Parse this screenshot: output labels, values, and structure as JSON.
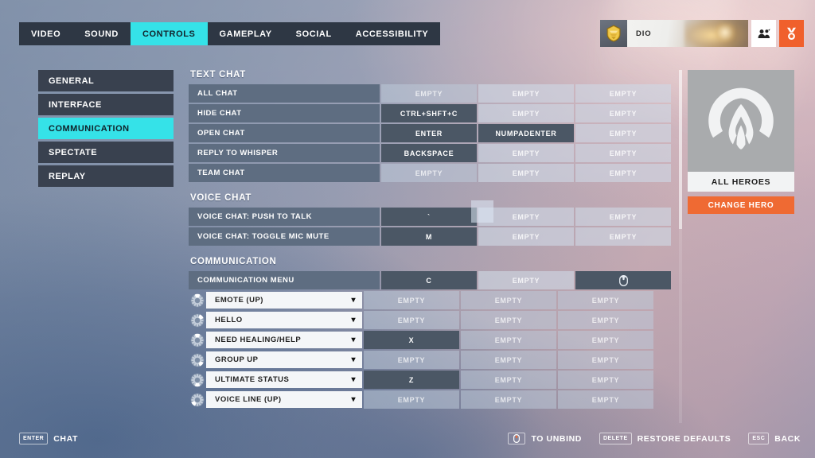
{
  "nav": {
    "tabs": [
      {
        "label": "VIDEO",
        "active": false
      },
      {
        "label": "SOUND",
        "active": false
      },
      {
        "label": "CONTROLS",
        "active": true
      },
      {
        "label": "GAMEPLAY",
        "active": false
      },
      {
        "label": "SOCIAL",
        "active": false
      },
      {
        "label": "ACCESSIBILITY",
        "active": false
      }
    ]
  },
  "player": {
    "name": "DIO",
    "badge_icon": "rank-badge-icon",
    "group_icon": "group-icon",
    "medal_icon": "medal-icon"
  },
  "sidebar": {
    "items": [
      {
        "label": "GENERAL",
        "active": false
      },
      {
        "label": "INTERFACE",
        "active": false
      },
      {
        "label": "COMMUNICATION",
        "active": true
      },
      {
        "label": "SPECTATE",
        "active": false
      },
      {
        "label": "REPLAY",
        "active": false
      }
    ]
  },
  "empty_label": "EMPTY",
  "sections": [
    {
      "title": "TEXT CHAT",
      "rows": [
        {
          "label": "ALL CHAT",
          "bindings": [
            {
              "value": "EMPTY",
              "state": "dim"
            },
            {
              "value": "EMPTY",
              "state": "empty"
            },
            {
              "value": "EMPTY",
              "state": "empty"
            }
          ]
        },
        {
          "label": "HIDE CHAT",
          "bindings": [
            {
              "value": "CTRL+SHFT+C",
              "state": "bound"
            },
            {
              "value": "EMPTY",
              "state": "empty"
            },
            {
              "value": "EMPTY",
              "state": "empty"
            }
          ]
        },
        {
          "label": "OPEN CHAT",
          "bindings": [
            {
              "value": "ENTER",
              "state": "bound"
            },
            {
              "value": "NUMPADENTER",
              "state": "bound"
            },
            {
              "value": "EMPTY",
              "state": "empty"
            }
          ]
        },
        {
          "label": "REPLY TO WHISPER",
          "bindings": [
            {
              "value": "BACKSPACE",
              "state": "bound"
            },
            {
              "value": "EMPTY",
              "state": "empty"
            },
            {
              "value": "EMPTY",
              "state": "empty"
            }
          ]
        },
        {
          "label": "TEAM CHAT",
          "bindings": [
            {
              "value": "EMPTY",
              "state": "dim"
            },
            {
              "value": "EMPTY",
              "state": "empty"
            },
            {
              "value": "EMPTY",
              "state": "empty"
            }
          ]
        }
      ]
    },
    {
      "title": "VOICE CHAT",
      "rows": [
        {
          "label": "VOICE CHAT: PUSH TO TALK",
          "bindings": [
            {
              "value": "`",
              "state": "bound"
            },
            {
              "value": "EMPTY",
              "state": "empty"
            },
            {
              "value": "EMPTY",
              "state": "empty"
            }
          ]
        },
        {
          "label": "VOICE CHAT: TOGGLE MIC MUTE",
          "bindings": [
            {
              "value": "M",
              "state": "bound"
            },
            {
              "value": "EMPTY",
              "state": "empty"
            },
            {
              "value": "EMPTY",
              "state": "empty"
            }
          ]
        }
      ]
    },
    {
      "title": "COMMUNICATION",
      "rows": [
        {
          "label": "COMMUNICATION MENU",
          "bindings": [
            {
              "value": "C",
              "state": "bound"
            },
            {
              "value": "EMPTY",
              "state": "empty"
            },
            {
              "value": "",
              "state": "bound",
              "icon": "mouse-middle-click-icon"
            }
          ]
        },
        {
          "label": "EMOTE (UP)",
          "dropdown": true,
          "wheel": 0,
          "bindings": [
            {
              "value": "EMPTY",
              "state": "dim"
            },
            {
              "value": "EMPTY",
              "state": "dim"
            },
            {
              "value": "EMPTY",
              "state": "dim"
            }
          ]
        },
        {
          "label": "HELLO",
          "dropdown": true,
          "wheel": 1,
          "bindings": [
            {
              "value": "EMPTY",
              "state": "dim"
            },
            {
              "value": "EMPTY",
              "state": "dim"
            },
            {
              "value": "EMPTY",
              "state": "dim"
            }
          ]
        },
        {
          "label": "NEED HEALING/HELP",
          "dropdown": true,
          "wheel": 2,
          "bindings": [
            {
              "value": "X",
              "state": "bound"
            },
            {
              "value": "EMPTY",
              "state": "dim"
            },
            {
              "value": "EMPTY",
              "state": "dim"
            }
          ]
        },
        {
          "label": "GROUP UP",
          "dropdown": true,
          "wheel": 3,
          "bindings": [
            {
              "value": "EMPTY",
              "state": "dim"
            },
            {
              "value": "EMPTY",
              "state": "dim"
            },
            {
              "value": "EMPTY",
              "state": "dim"
            }
          ]
        },
        {
          "label": "ULTIMATE STATUS",
          "dropdown": true,
          "wheel": 4,
          "bindings": [
            {
              "value": "Z",
              "state": "bound"
            },
            {
              "value": "EMPTY",
              "state": "dim"
            },
            {
              "value": "EMPTY",
              "state": "dim"
            }
          ]
        },
        {
          "label": "VOICE LINE (UP)",
          "dropdown": true,
          "wheel": 5,
          "bindings": [
            {
              "value": "EMPTY",
              "state": "dim"
            },
            {
              "value": "EMPTY",
              "state": "dim"
            },
            {
              "value": "EMPTY",
              "state": "dim"
            }
          ]
        }
      ]
    }
  ],
  "hero_panel": {
    "name": "ALL HEROES",
    "change_label": "CHANGE HERO",
    "logo_icon": "overwatch-logo-icon",
    "accent": "#ef6a33"
  },
  "bottom": {
    "left": {
      "key": "ENTER",
      "label": "CHAT"
    },
    "right": [
      {
        "key": "",
        "icon": "mouse-icon",
        "label": "TO UNBIND"
      },
      {
        "key": "DELETE",
        "label": "RESTORE DEFAULTS"
      },
      {
        "key": "ESC",
        "label": "BACK"
      }
    ]
  },
  "theme": {
    "accent_cyan": "#35e2e8",
    "accent_orange": "#ef6a33",
    "label_bg": "#5e6d81",
    "bound_bg": "#4b5765"
  }
}
